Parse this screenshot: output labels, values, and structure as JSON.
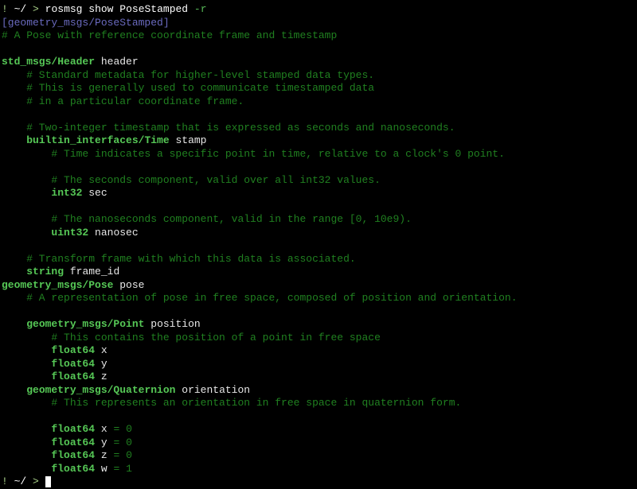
{
  "prompt": {
    "mark": "!",
    "path": "~/",
    "gt": ">",
    "cmd_white": "rosmsg show PoseStamped ",
    "cmd_green": "-r"
  },
  "header": "[geometry_msgs/PoseStamped]",
  "l1": "# A Pose with reference coordinate frame and timestamp",
  "l2_type": "std_msgs/Header",
  "l2_name": "header",
  "l3": "    # Standard metadata for higher-level stamped data types.",
  "l4": "    # This is generally used to communicate timestamped data",
  "l5": "    # in a particular coordinate frame.",
  "l6": "    # Two-integer timestamp that is expressed as seconds and nanoseconds.",
  "l7_type": "builtin_interfaces/Time",
  "l7_name": "stamp",
  "l8": "        # Time indicates a specific point in time, relative to a clock's 0 point.",
  "l9": "        # The seconds component, valid over all int32 values.",
  "l10_type": "int32",
  "l10_name": "sec",
  "l11": "        # The nanoseconds component, valid in the range [0, 10e9).",
  "l12_type": "uint32",
  "l12_name": "nanosec",
  "l13": "    # Transform frame with which this data is associated.",
  "l14_type": "string",
  "l14_name": "frame_id",
  "l15_type": "geometry_msgs/Pose",
  "l15_name": "pose",
  "l16": "    # A representation of pose in free space, composed of position and orientation.",
  "l17_type": "geometry_msgs/Point",
  "l17_name": "position",
  "l18": "        # This contains the position of a point in free space",
  "l19_type": "float64",
  "l19_name": "x",
  "l20_type": "float64",
  "l20_name": "y",
  "l21_type": "float64",
  "l21_name": "z",
  "l22_type": "geometry_msgs/Quaternion",
  "l22_name": "orientation",
  "l23": "        # This represents an orientation in free space in quaternion form.",
  "q_type": "float64",
  "qx_name": "x",
  "qy_name": "y",
  "qz_name": "z",
  "qw_name": "w",
  "eq": "=",
  "zero": "0",
  "one": "1",
  "indent4": "    ",
  "indent8": "        ",
  "space": " "
}
